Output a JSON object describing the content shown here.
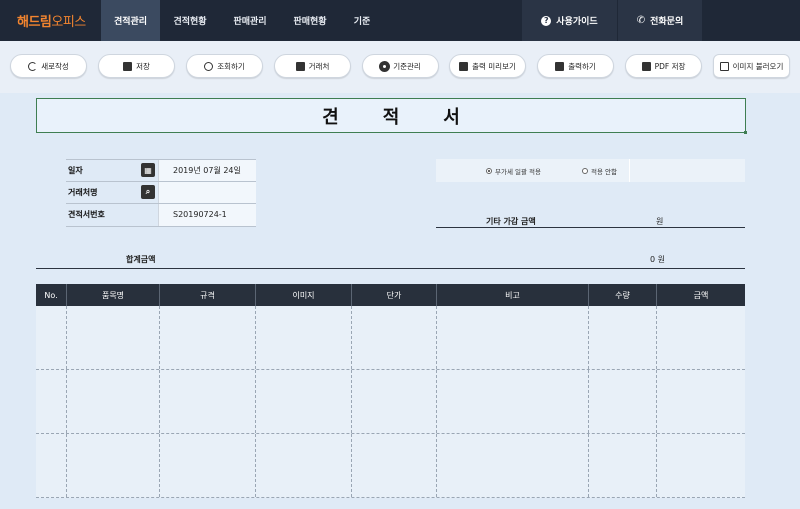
{
  "nav": {
    "logo_bold": "해드림",
    "logo_rest": "오피스",
    "items": [
      "견적관리",
      "견적현황",
      "판매관리",
      "판매현황",
      "기준"
    ],
    "active": 0,
    "guide": "사용가이드",
    "phone": "전화문의",
    "guide_icon": "question-icon",
    "phone_icon": "phone-icon"
  },
  "toolbar": {
    "new": "새로작성",
    "save": "저장",
    "search": "조회하기",
    "client": "거래처",
    "standard": "기준관리",
    "preview": "출력 미리보기",
    "print": "출력하기",
    "pdf": "PDF 저장",
    "image": "이미지 불러오기"
  },
  "doc": {
    "title": "견적서"
  },
  "info": {
    "date_label": "일자",
    "date_value": "2019년 07월 24일",
    "client_label": "거래처명",
    "client_value": "",
    "number_label": "견적서번호",
    "number_value": "S20190724-1"
  },
  "vat": {
    "option_included": "부가세 일괄 적용",
    "option_excluded": "적용 안함",
    "selected": "부가세 일괄 적용"
  },
  "extra": {
    "label": "기타 가감 금액",
    "unit": "원"
  },
  "sum": {
    "label": "합계금액",
    "value": "0 원"
  },
  "table": {
    "headers": [
      "No.",
      "품목명",
      "규격",
      "이미지",
      "단가",
      "비고",
      "수량",
      "금액"
    ],
    "rows": [
      [
        "",
        "",
        "",
        "",
        "",
        "",
        "",
        ""
      ],
      [
        "",
        "",
        "",
        "",
        "",
        "",
        "",
        ""
      ],
      [
        "",
        "",
        "",
        "",
        "",
        "",
        "",
        ""
      ]
    ]
  }
}
